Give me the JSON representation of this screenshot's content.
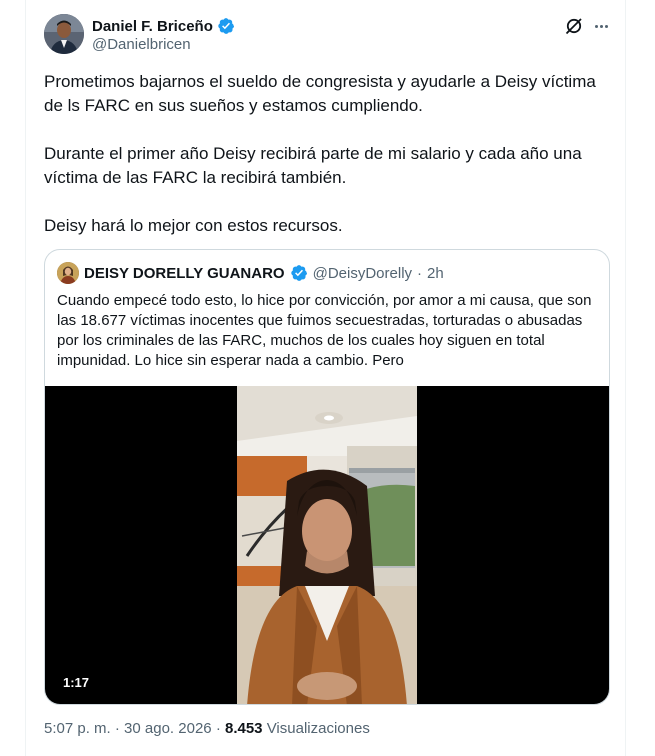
{
  "tweet": {
    "author": {
      "display_name": "Daniel F. Briceño",
      "handle": "@Danielbricen",
      "verified": true
    },
    "paragraphs": [
      "Prometimos bajarnos el sueldo de congresista y ayudarle a Deisy víctima de ls FARC en sus sueños y estamos cumpliendo.",
      "Durante el primer año Deisy recibirá parte de mi salario y cada año una víctima de las FARC la recibirá también.",
      "Deisy hará lo mejor con estos recursos."
    ],
    "quote": {
      "author": {
        "display_name": "DEISY DORELLY GUANARO",
        "handle": "@DeisyDorelly",
        "verified": true
      },
      "separator": "·",
      "time": "2h",
      "text": "Cuando empecé todo esto, lo hice por convicción, por amor a mi causa, que son las 18.677 víctimas inocentes que fuimos secuestradas, torturadas o abusadas por los criminales de las FARC, muchos de los cuales hoy siguen en total impunidad. Lo hice sin esperar nada a cambio. Pero",
      "video": {
        "duration": "1:17"
      }
    },
    "meta": {
      "time": "5:07 p. m.",
      "sep1": "·",
      "date": "30 ago. 2026",
      "sep2": "·",
      "views_count": "8.453",
      "views_label": "Visualizaciones"
    }
  },
  "icons": {
    "verified": "verified-badge-icon",
    "grok": "grok-icon",
    "more": "more-options-icon"
  },
  "colors": {
    "text_primary": "#0f1419",
    "text_secondary": "#536471",
    "verified_blue": "#1d9bf0",
    "border": "#cfd9de"
  }
}
